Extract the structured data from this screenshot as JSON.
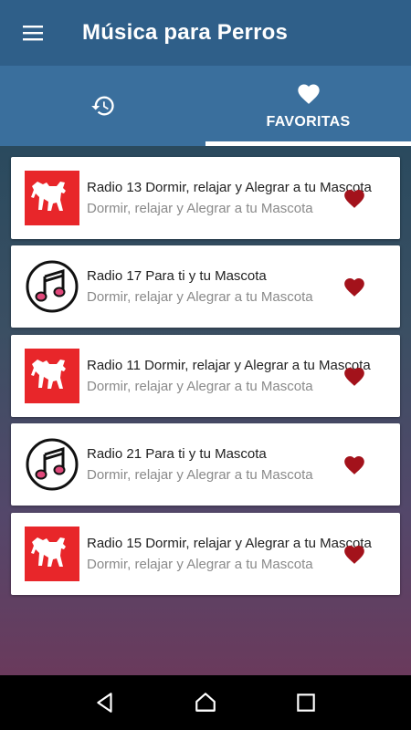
{
  "app": {
    "title": "Música para Perros"
  },
  "tabs": [
    {
      "icon": "history-icon",
      "label": ""
    },
    {
      "icon": "heart-icon",
      "label": "FAVORITAS",
      "selected": true
    }
  ],
  "stations": [
    {
      "title": "Radio 13 Dormir, relajar y Alegrar a tu Mascota",
      "subtitle": "Dormir, relajar y Alegrar a tu Mascota",
      "image": "dog-logo"
    },
    {
      "title": "Radio 17 Para ti y tu Mascota",
      "subtitle": "Dormir, relajar y Alegrar a tu Mascota",
      "image": "music-note"
    },
    {
      "title": "Radio 11 Dormir, relajar y Alegrar a tu Mascota",
      "subtitle": "Dormir, relajar y Alegrar a tu Mascota",
      "image": "dog-logo"
    },
    {
      "title": "Radio 21 Para ti y tu Mascota",
      "subtitle": "Dormir, relajar y Alegrar a tu Mascota",
      "image": "music-note"
    },
    {
      "title": "Radio 15 Dormir, relajar y Alegrar a tu Mascota",
      "subtitle": "Dormir, relajar y Alegrar a tu Mascota",
      "image": "dog-logo"
    }
  ],
  "colors": {
    "appbar": "#2f5f89",
    "tabs": "#3a6f9d",
    "heart": "#a3121b",
    "dog_logo_bg": "#e8262a"
  },
  "navbar": {
    "buttons": [
      "back-icon",
      "home-icon",
      "recents-icon"
    ]
  }
}
